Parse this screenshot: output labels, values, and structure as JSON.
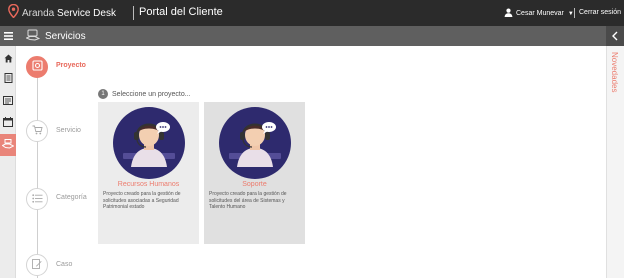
{
  "header": {
    "logo_prefix": "Aranda",
    "logo_suffix": "Service Desk",
    "portal_title": "Portal del Cliente",
    "user_name": "Cesar Munevar",
    "logout_label": "Cerrar sesión"
  },
  "subheader": {
    "title": "Servicios"
  },
  "steps": [
    {
      "label": "Proyecto",
      "active": true
    },
    {
      "label": "Servicio",
      "active": false
    },
    {
      "label": "Categoría",
      "active": false
    },
    {
      "label": "Caso",
      "active": false
    }
  ],
  "hint": {
    "number": "1",
    "text": "Seleccione un proyecto..."
  },
  "projects": [
    {
      "name": "Recursos Humanos",
      "description": "Proyecto creado para la gestión de solicitudes asociadas a Seguridad Patrimonial estado"
    },
    {
      "name": "Soporte",
      "description": "Proyecto creado para la gestión de solicitudes del área de Sistemas y Talento Humano"
    }
  ],
  "right_panel": {
    "label": "Novedades"
  },
  "colors": {
    "accent": "#ec7c6e",
    "topbar": "#2b2b2b",
    "subbar": "#5f5f5f",
    "avatar_bg": "#2e2a6e",
    "card1_bg": "#ececec",
    "card2_bg": "#e0e0e0"
  }
}
